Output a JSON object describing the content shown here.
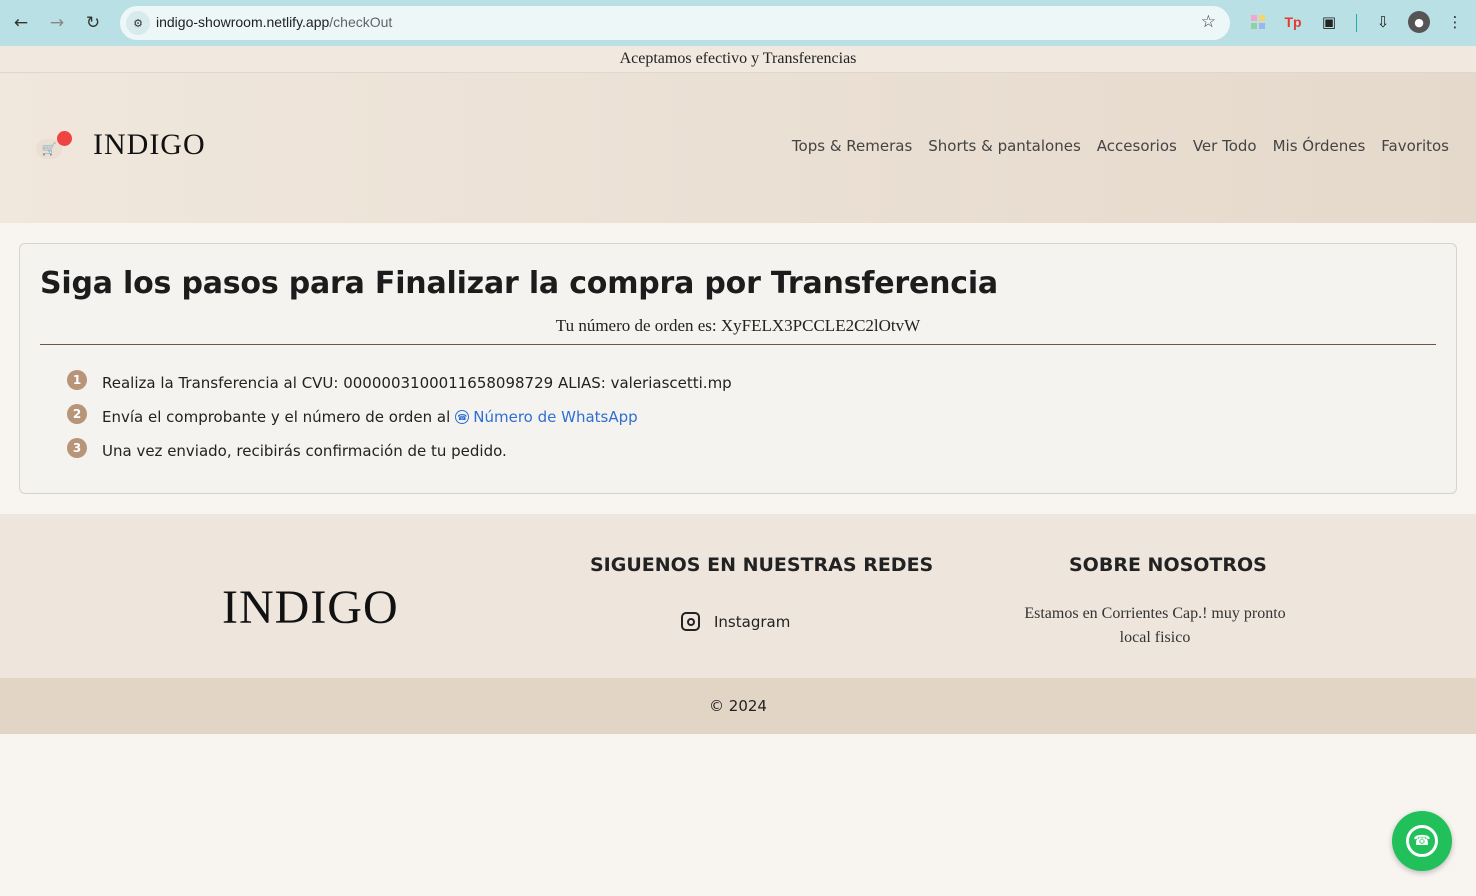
{
  "browser": {
    "url_host": "indigo-showroom.netlify.app",
    "url_path": "/checkOut",
    "back_icon": "arrow-left-icon",
    "forward_icon": "arrow-right-icon",
    "reload_icon": "reload-icon",
    "ext_tp_label": "Tp"
  },
  "announcement": "Aceptamos efectivo y Transferencias",
  "header": {
    "brand": "INDIGO",
    "nav": [
      "Tops & Remeras",
      "Shorts & pantalones",
      "Accesorios",
      "Ver Todo",
      "Mis Órdenes",
      "Favoritos"
    ]
  },
  "checkout": {
    "title": "Siga los pasos para Finalizar la compra por Transferencia",
    "order_line": "Tu número de orden es: XyFELX3PCCLE2C2lOtvW",
    "steps": [
      {
        "num": "1",
        "text": "Realiza la Transferencia al CVU: 0000003100011658098729 ALIAS: valeriascetti.mp"
      },
      {
        "num": "2",
        "text": "Envía el comprobante y el número de orden al",
        "link": "Número de WhatsApp"
      },
      {
        "num": "3",
        "text": "Una vez enviado, recibirás confirmación de tu pedido."
      }
    ]
  },
  "footer": {
    "brand": "INDIGO",
    "social_title": "SIGUENOS EN NUESTRAS REDES",
    "instagram_label": "Instagram",
    "about_title": "SOBRE NOSOTROS",
    "about_text": "Estamos en Corrientes Cap.! muy pronto local fisico",
    "copyright": "© 2024"
  },
  "colors": {
    "chrome_bg": "#b9e0e4",
    "step_badge": "#b89478",
    "link": "#2f6fd1",
    "whatsapp_green": "#22c05a",
    "cart_badge": "#ef4444"
  }
}
